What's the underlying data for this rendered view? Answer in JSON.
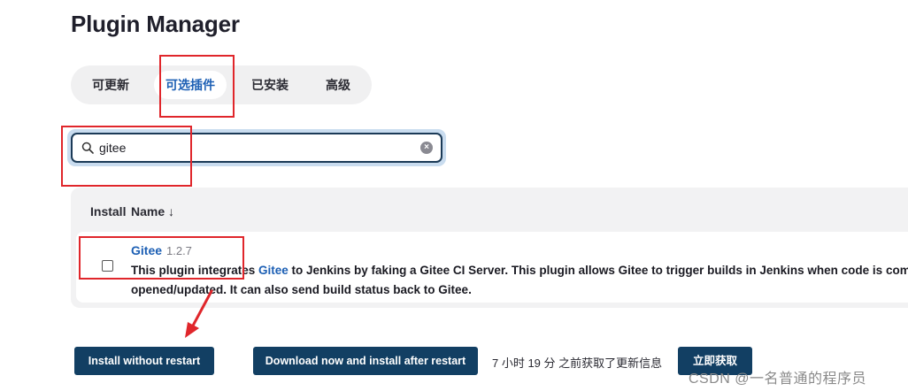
{
  "page_title": "Plugin Manager",
  "tabs": [
    {
      "label": "可更新",
      "active": false
    },
    {
      "label": "可选插件",
      "active": true
    },
    {
      "label": "已安装",
      "active": false
    },
    {
      "label": "高级",
      "active": false
    }
  ],
  "search": {
    "value": "gitee",
    "icon": "search-icon",
    "clear_icon": "clear-icon"
  },
  "table": {
    "headers": {
      "install": "Install",
      "name": "Name ↓"
    },
    "rows": [
      {
        "name": "Gitee",
        "version": "1.2.7",
        "checked": false,
        "desc_part1": "This plugin integrates ",
        "desc_link": "Gitee",
        "desc_part2": " to Jenkins by faking a Gitee CI Server. This plugin allows Gitee to trigger builds in Jenkins when code is committed",
        "desc_line2": "opened/updated. It can also send build status back to Gitee."
      }
    ]
  },
  "actions": {
    "install_without_restart": "Install without restart",
    "download_install_after_restart": "Download now and install after restart",
    "status_text": "7 小时 19 分 之前获取了更新信息",
    "fetch_now": "立即获取"
  },
  "watermark": "CSDN @一名普通的程序员",
  "colors": {
    "accent": "#1c5fb4",
    "button_bg": "#123f63",
    "annotation": "#e0262b"
  }
}
